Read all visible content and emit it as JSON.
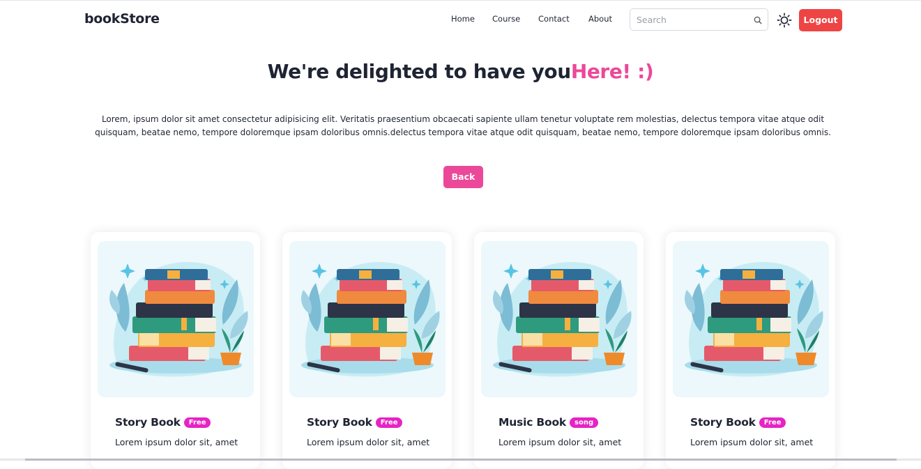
{
  "navbar": {
    "brand": "bookStore",
    "menu": [
      "Home",
      "Course",
      "Contact",
      "About"
    ],
    "search_placeholder": "Search",
    "logout_label": "Logout"
  },
  "hero": {
    "headline_main": "We're delighted to have you",
    "headline_accent": "Here! :)",
    "paragraph": "Lorem, ipsum dolor sit amet consectetur adipisicing elit. Veritatis praesentium obcaecati sapiente ullam tenetur voluptate rem molestias, delectus tempora vitae atque odit quisquam, beatae nemo, tempore doloremque ipsam doloribus omnis.delectus tempora vitae atque odit quisquam, beatae nemo, tempore doloremque ipsam doloribus omnis.",
    "back_label": "Back"
  },
  "cards": [
    {
      "title": "Story Book",
      "badge": "Free",
      "description": "Lorem ipsum dolor sit, amet"
    },
    {
      "title": "Story Book",
      "badge": "Free",
      "description": "Lorem ipsum dolor sit, amet"
    },
    {
      "title": "Music Book",
      "badge": "song",
      "description": "Lorem ipsum dolor sit, amet"
    },
    {
      "title": "Story Book",
      "badge": "Free",
      "description": "Lorem ipsum dolor sit, amet"
    }
  ],
  "colors": {
    "accent_pink": "#ec4899",
    "logout_red": "#ef4444",
    "badge_magenta": "#e623c4",
    "card_image_bg": "#ecf8fb",
    "text_dark": "#1f2433"
  },
  "icons": {
    "search": "search-icon",
    "theme": "sun-icon",
    "card_image": "book-stack-illustration"
  }
}
